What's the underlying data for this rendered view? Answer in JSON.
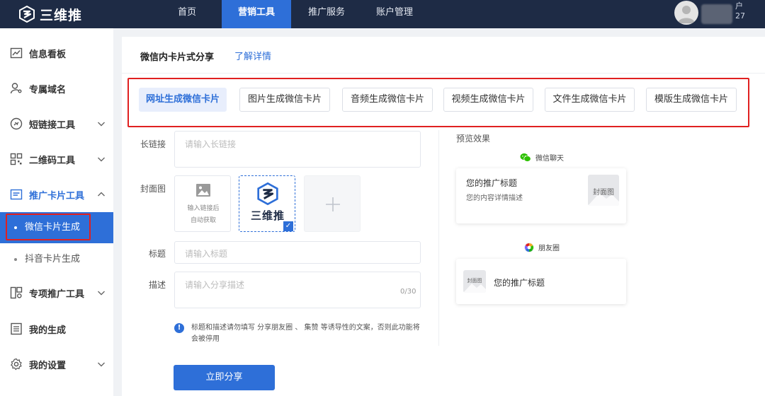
{
  "app": {
    "brand": "三维推"
  },
  "nav": {
    "items": [
      {
        "label": "首页"
      },
      {
        "label": "营销工具"
      },
      {
        "label": "推广服务"
      },
      {
        "label": "账户管理"
      }
    ],
    "user_partial": "户\n27"
  },
  "sidebar": {
    "items": [
      {
        "label": "信息看板",
        "icon": "chart-icon"
      },
      {
        "label": "专属域名",
        "icon": "user-key-icon"
      },
      {
        "label": "短链接工具",
        "icon": "link-icon"
      },
      {
        "label": "二维码工具",
        "icon": "qrcode-icon"
      },
      {
        "label": "推广卡片工具",
        "icon": "card-icon"
      },
      {
        "label": "专项推广工具",
        "icon": "special-icon"
      },
      {
        "label": "我的生成",
        "icon": "list-icon"
      },
      {
        "label": "我的设置",
        "icon": "gear-icon"
      }
    ],
    "sub_items": [
      {
        "label": "微信卡片生成"
      },
      {
        "label": "抖音卡片生成"
      }
    ]
  },
  "main": {
    "title": "微信内卡片式分享",
    "link": "了解详情",
    "tabs": [
      {
        "label": "网址生成微信卡片"
      },
      {
        "label": "图片生成微信卡片"
      },
      {
        "label": "音频生成微信卡片"
      },
      {
        "label": "视频生成微信卡片"
      },
      {
        "label": "文件生成微信卡片"
      },
      {
        "label": "模版生成微信卡片"
      }
    ],
    "form": {
      "long_link_label": "长链接",
      "long_link_placeholder": "请输入长链接",
      "cover_label": "封面图",
      "cover_auto_line1": "输入链接后",
      "cover_auto_line2": "自动获取",
      "cover_logo_text": "三维推",
      "title_label": "标题",
      "title_placeholder": "请输入标题",
      "desc_label": "描述",
      "desc_placeholder": "请输入分享描述",
      "desc_counter": "0/30",
      "notice": "标题和描述请勿填写 分享朋友圈 、 集赞 等诱导性的文案，否则此功能将会被停用",
      "submit": "立即分享"
    },
    "preview": {
      "title": "预览效果",
      "wechat_label": "微信聊天",
      "moments_label": "朋友圈",
      "card_title": "您的推广标题",
      "card_desc": "您的内容详情描述",
      "thumb_label": "封面图"
    }
  },
  "colors": {
    "accent": "#2e6fd8",
    "topbar": "#1e2b45",
    "highlight": "#e02020"
  }
}
